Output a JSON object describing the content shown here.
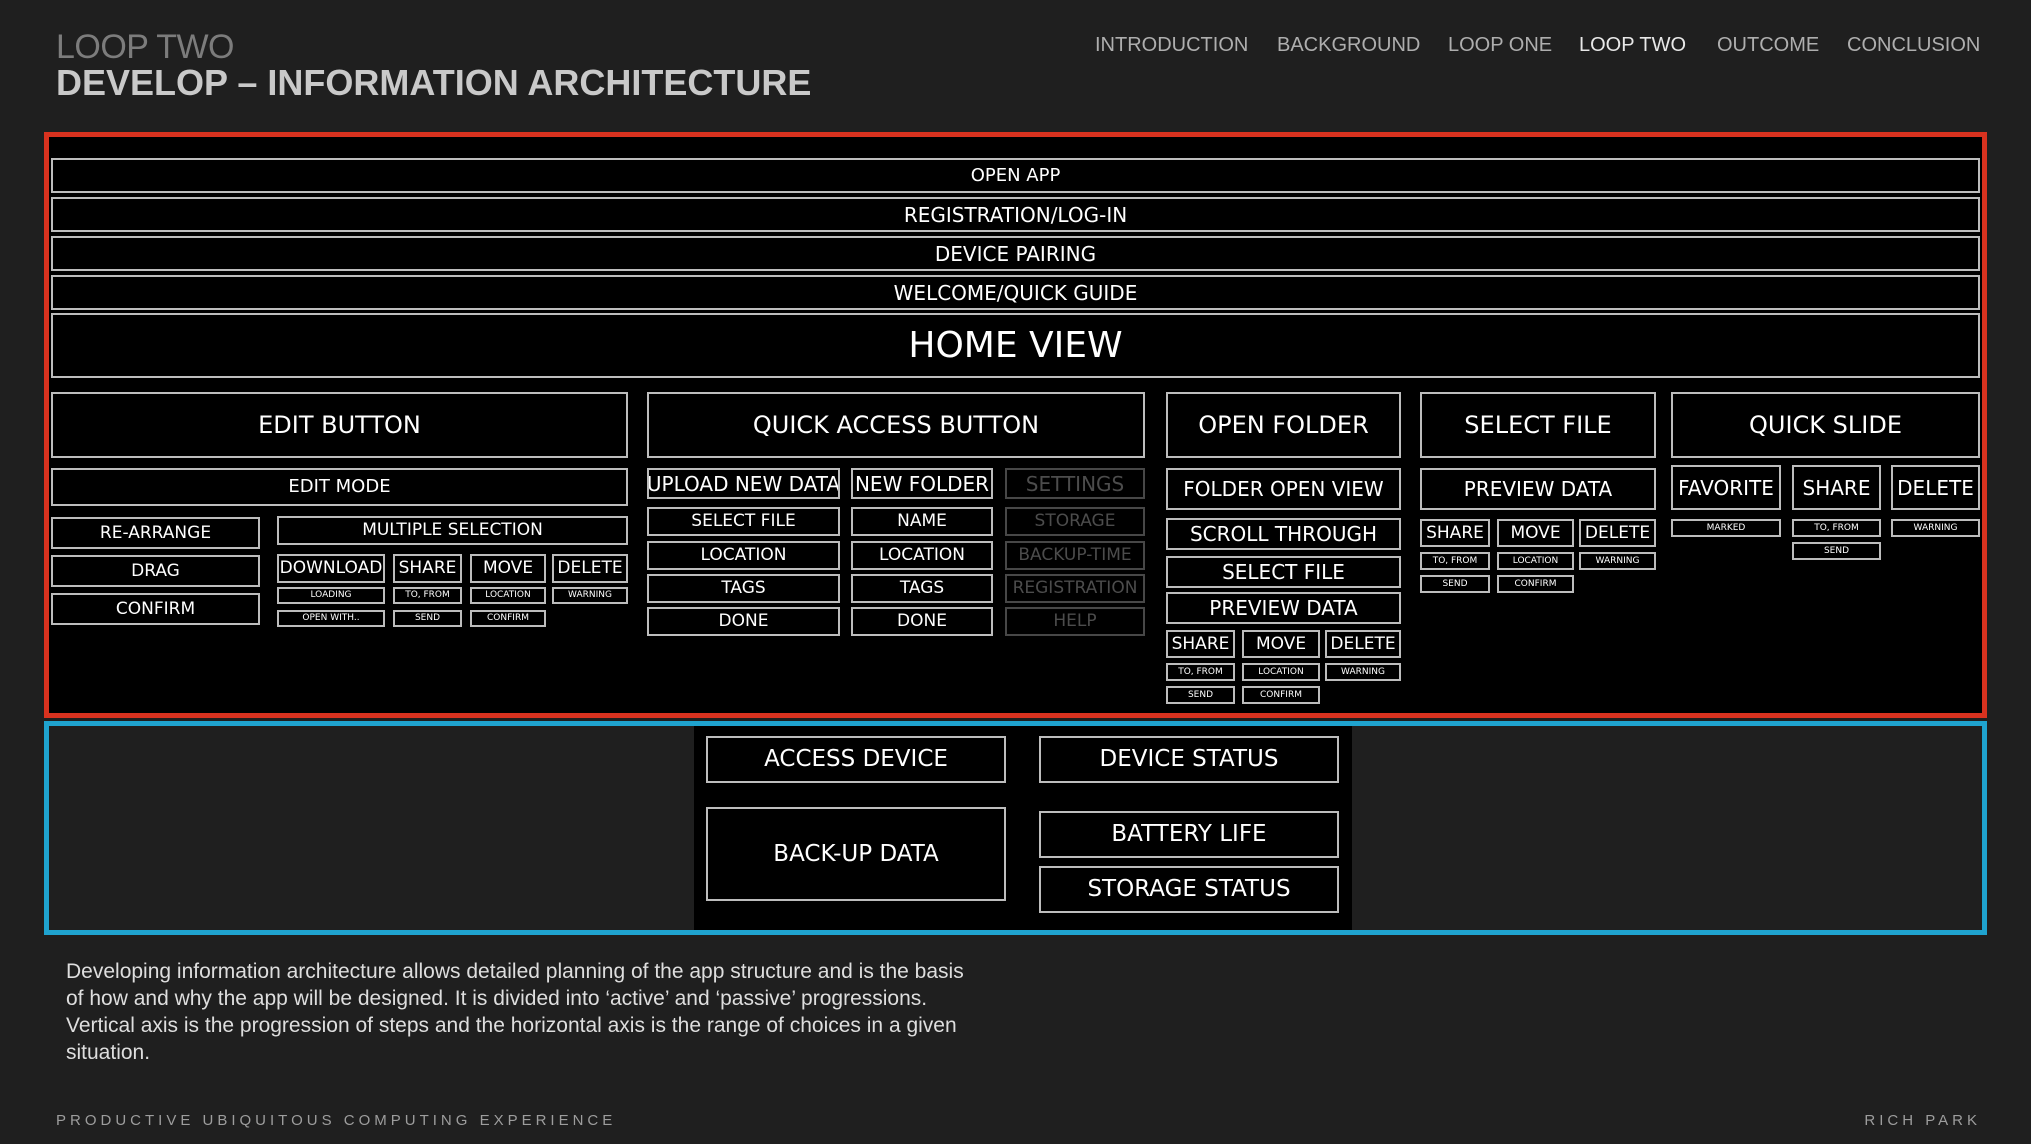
{
  "header": {
    "kicker": "LOOP TWO",
    "title": "DEVELOP – INFORMATION ARCHITECTURE"
  },
  "nav": [
    "INTRODUCTION",
    "BACKGROUND",
    "LOOP ONE",
    "LOOP TWO",
    "OUTCOME",
    "CONCLUSION"
  ],
  "nav_active": "LOOP TWO",
  "colors": {
    "active_frame": "#d8321f",
    "passive_frame": "#1fa3cf",
    "background": "#1f1f1f"
  },
  "diagram": {
    "flow": {
      "open_app": "OPEN APP",
      "registration": "REGISTRATION/LOG-IN",
      "device_pairing": "DEVICE PAIRING",
      "welcome": "WELCOME/QUICK GUIDE",
      "home_view": "HOME VIEW"
    },
    "edit": {
      "header": "EDIT BUTTON",
      "mode": "EDIT MODE",
      "rearrange": "RE-ARRANGE",
      "drag": "DRAG",
      "confirm": "CONFIRM",
      "multiple_selection": "MULTIPLE SELECTION",
      "download": "DOWNLOAD",
      "share": "SHARE",
      "move": "MOVE",
      "delete": "DELETE",
      "loading": "LOADING",
      "to_from": "TO, FROM",
      "location": "LOCATION",
      "warning": "WARNING",
      "open_with": "OPEN WITH..",
      "send": "SEND",
      "confirm_small": "CONFIRM"
    },
    "quick_access": {
      "header": "QUICK ACCESS BUTTON",
      "upload_new_data": "UPLOAD NEW DATA",
      "upload_items": [
        "SELECT FILE",
        "LOCATION",
        "TAGS",
        "DONE"
      ],
      "new_folder": "NEW FOLDER",
      "folder_items": [
        "NAME",
        "LOCATION",
        "TAGS",
        "DONE"
      ],
      "settings": "SETTINGS",
      "settings_items": [
        "STORAGE",
        "BACKUP-TIME",
        "REGISTRATION",
        "HELP"
      ]
    },
    "open_folder": {
      "header": "OPEN FOLDER",
      "steps": [
        "FOLDER OPEN VIEW",
        "SCROLL THROUGH",
        "SELECT FILE",
        "PREVIEW DATA"
      ],
      "share": "SHARE",
      "move": "MOVE",
      "delete": "DELETE",
      "to_from": "TO, FROM",
      "location": "LOCATION",
      "warning": "WARNING",
      "send": "SEND",
      "confirm": "CONFIRM"
    },
    "select_file": {
      "header": "SELECT FILE",
      "preview": "PREVIEW DATA",
      "share": "SHARE",
      "move": "MOVE",
      "delete": "DELETE",
      "to_from": "TO, FROM",
      "location": "LOCATION",
      "warning": "WARNING",
      "send": "SEND",
      "confirm": "CONFIRM"
    },
    "quick_slide": {
      "header": "QUICK SLIDE",
      "favorite": "FAVORITE",
      "share": "SHARE",
      "delete": "DELETE",
      "marked": "MARKED",
      "to_from": "TO, FROM",
      "send": "SEND",
      "warning": "WARNING"
    },
    "passive": {
      "access_device": "ACCESS DEVICE",
      "device_status": "DEVICE STATUS",
      "backup_data": "BACK-UP DATA",
      "battery_life": "BATTERY LIFE",
      "storage_status": "STORAGE STATUS"
    }
  },
  "description": "Developing information architecture allows detailed planning of the app structure and is the basis of how and why the app will be designed. It is divided into ‘active’ and ‘passive’ progressions. Vertical axis is the progression of steps and the horizontal axis is the range of choices in a given situation.",
  "footer": {
    "left": "PRODUCTIVE UBIQUITOUS COMPUTING EXPERIENCE",
    "right": "RICH PARK"
  }
}
